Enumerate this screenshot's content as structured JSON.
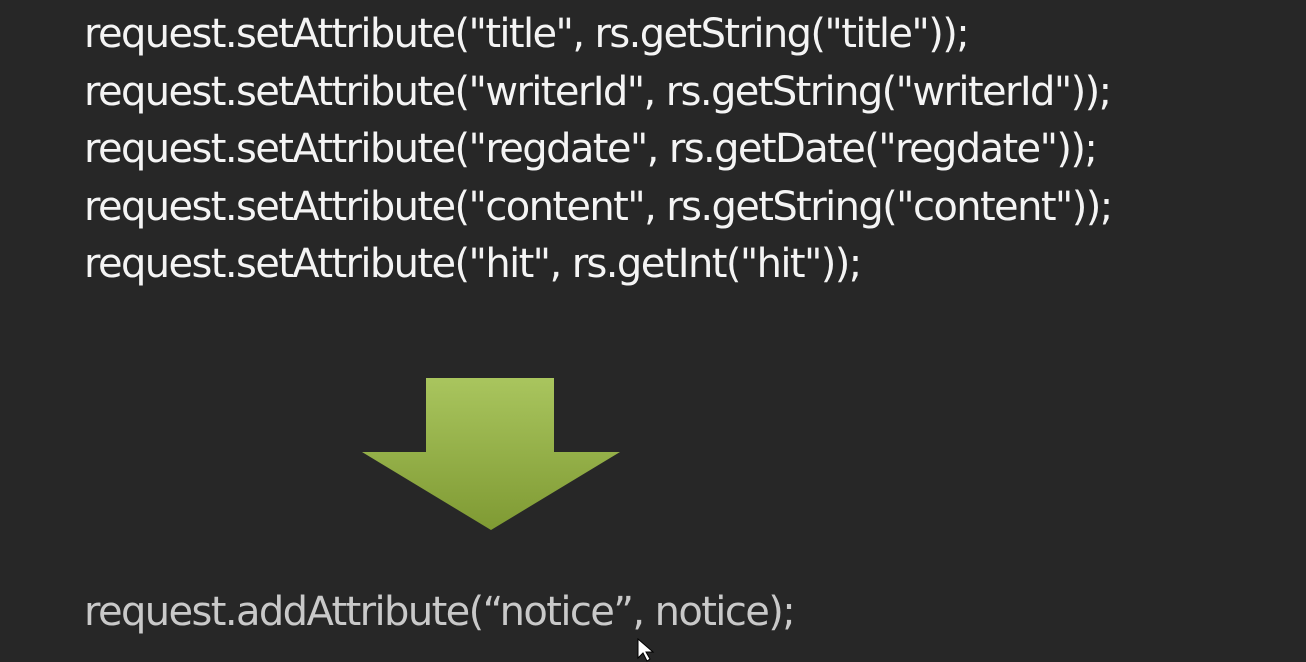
{
  "code": {
    "lines": [
      "request.setAttribute(\"title\", rs.getString(\"title\"));",
      "request.setAttribute(\"writerId\", rs.getString(\"writerId\"));",
      "request.setAttribute(\"regdate\", rs.getDate(\"regdate\"));",
      "request.setAttribute(\"content\", rs.getString(\"content\"));",
      "request.setAttribute(\"hit\", rs.getInt(\"hit\"));"
    ]
  },
  "result": {
    "line": "request.addAttribute(“notice”, notice);"
  },
  "colors": {
    "background": "#272727",
    "text": "#f4f4f4",
    "result_text": "#c9c9c9",
    "arrow_light": "#a6c15a",
    "arrow_dark": "#7f9a33"
  },
  "icons": {
    "arrow": "arrow-down-icon",
    "cursor": "mouse-pointer-icon"
  }
}
